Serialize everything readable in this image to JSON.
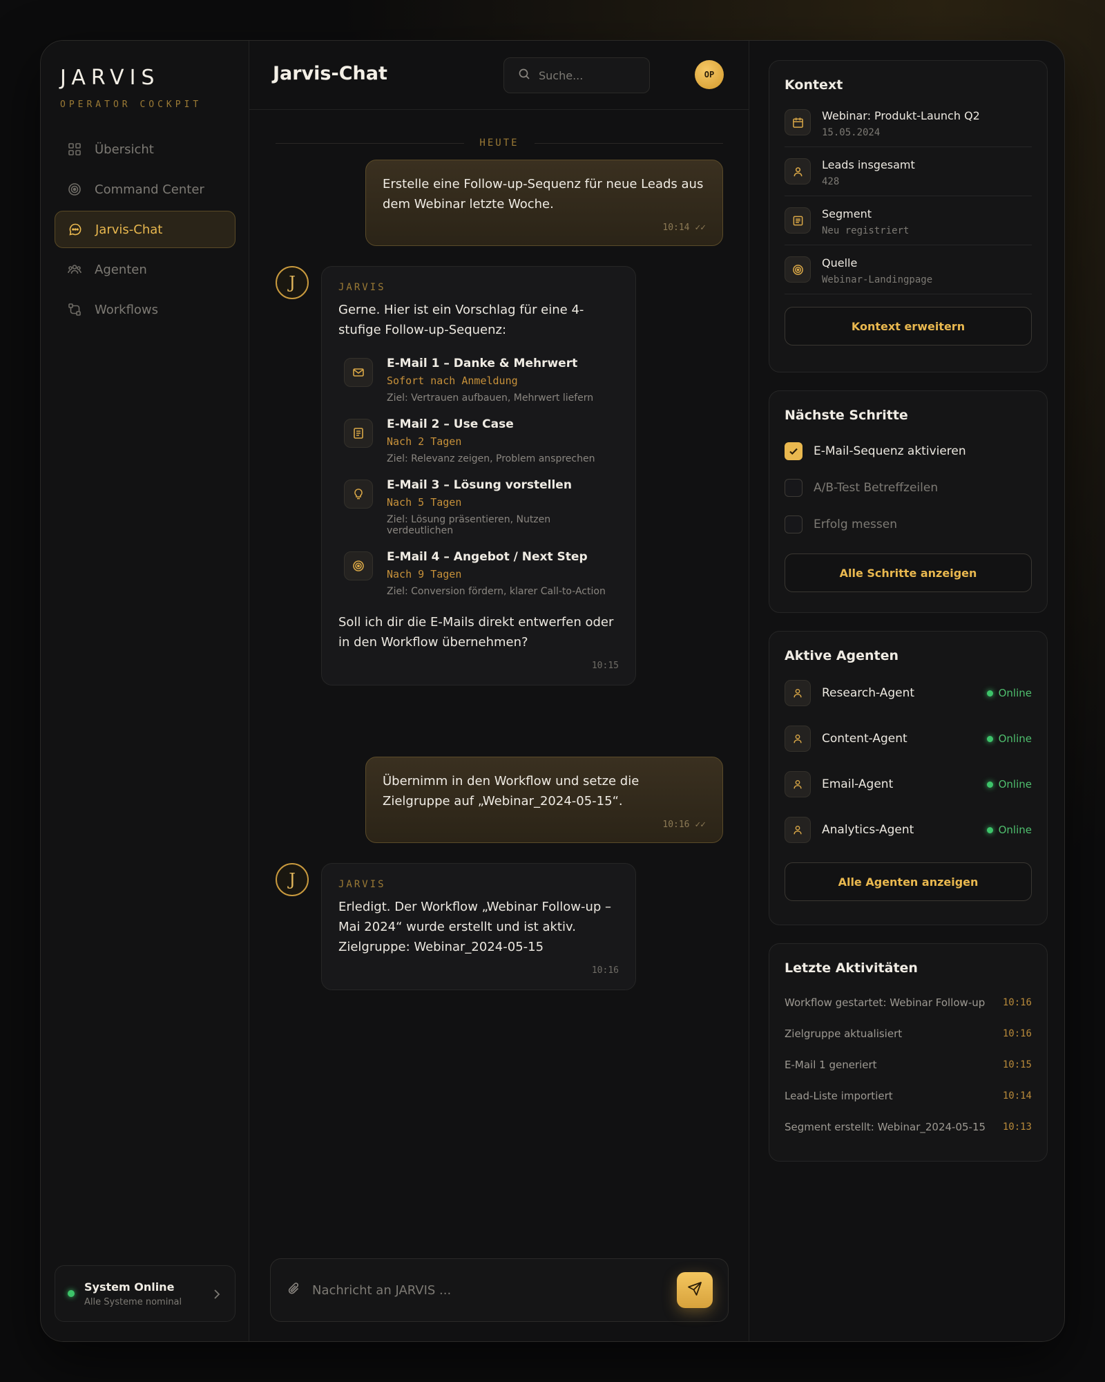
{
  "brand": {
    "name": "JARVIS",
    "subtitle": "OPERATOR COCKPIT"
  },
  "nav": [
    {
      "label": "Übersicht",
      "icon": "grid-icon",
      "active": false
    },
    {
      "label": "Command Center",
      "icon": "target-icon",
      "active": false
    },
    {
      "label": "Jarvis-Chat",
      "icon": "chat-icon",
      "active": true
    },
    {
      "label": "Agenten",
      "icon": "users-icon",
      "active": false
    },
    {
      "label": "Workflows",
      "icon": "workflow-icon",
      "active": false
    }
  ],
  "system": {
    "title": "System Online",
    "subtitle": "Alle Systeme nominal"
  },
  "header": {
    "title": "Jarvis-Chat",
    "search_placeholder": "Suche...",
    "avatar_initials": "OP"
  },
  "chat": {
    "day_label": "HEUTE",
    "messages": [
      {
        "from": "user",
        "text": "Erstelle eine Follow-up-Sequenz für neue Leads aus dem Webinar letzte Woche.",
        "time": "10:14 ✓✓"
      },
      {
        "from": "bot",
        "name": "JARVIS",
        "avatar": "J",
        "intro": "Gerne. Hier ist ein Vorschlag für eine 4-stufige Follow-up-Sequenz:",
        "steps": [
          {
            "icon": "mail-icon",
            "title": "E-Mail 1 – Danke & Mehrwert",
            "timing": "Sofort nach Anmeldung",
            "goal": "Ziel: Vertrauen aufbauen, Mehrwert liefern"
          },
          {
            "icon": "document-icon",
            "title": "E-Mail 2 – Use Case",
            "timing": "Nach 2 Tagen",
            "goal": "Ziel: Relevanz zeigen, Problem ansprechen"
          },
          {
            "icon": "lightbulb-icon",
            "title": "E-Mail 3 – Lösung vorstellen",
            "timing": "Nach 5 Tagen",
            "goal": "Ziel: Lösung präsentieren, Nutzen verdeutlichen"
          },
          {
            "icon": "target-icon",
            "title": "E-Mail 4 – Angebot / Next Step",
            "timing": "Nach 9 Tagen",
            "goal": "Ziel: Conversion fördern, klarer Call-to-Action"
          }
        ],
        "outro": "Soll ich dir die E-Mails direkt entwerfen oder in den Workflow übernehmen?",
        "time": "10:15"
      },
      {
        "from": "user",
        "text": "Übernimm in den Workflow und setze die Zielgruppe auf „Webinar_2024-05-15“.",
        "time": "10:16 ✓✓"
      },
      {
        "from": "bot",
        "name": "JARVIS",
        "avatar": "J",
        "text": "Erledigt. Der Workflow „Webinar Follow-up – Mai 2024“ wurde erstellt und ist aktiv. Zielgruppe: Webinar_2024-05-15",
        "time": "10:16"
      }
    ],
    "composer_placeholder": "Nachricht an JARVIS ..."
  },
  "context": {
    "title": "Kontext",
    "rows": [
      {
        "icon": "calendar-icon",
        "title": "Webinar: Produkt-Launch Q2",
        "value": "15.05.2024"
      },
      {
        "icon": "user-icon",
        "title": "Leads insgesamt",
        "value": "428"
      },
      {
        "icon": "list-icon",
        "title": "Segment",
        "value": "Neu registriert"
      },
      {
        "icon": "target-icon",
        "title": "Quelle",
        "value": "Webinar-Landingpage"
      }
    ],
    "button": "Kontext erweitern"
  },
  "next_steps": {
    "title": "Nächste Schritte",
    "items": [
      {
        "label": "E-Mail-Sequenz aktivieren",
        "checked": true
      },
      {
        "label": "A/B-Test Betreffzeilen",
        "checked": false
      },
      {
        "label": "Erfolg messen",
        "checked": false
      }
    ],
    "button": "Alle Schritte anzeigen"
  },
  "agents": {
    "title": "Aktive Agenten",
    "items": [
      {
        "name": "Research-Agent",
        "status": "Online"
      },
      {
        "name": "Content-Agent",
        "status": "Online"
      },
      {
        "name": "Email-Agent",
        "status": "Online"
      },
      {
        "name": "Analytics-Agent",
        "status": "Online"
      }
    ],
    "button": "Alle Agenten anzeigen"
  },
  "activities": {
    "title": "Letzte Aktivitäten",
    "items": [
      {
        "label": "Workflow gestartet: Webinar Follow-up",
        "time": "10:16"
      },
      {
        "label": "Zielgruppe aktualisiert",
        "time": "10:16"
      },
      {
        "label": "E-Mail 1 generiert",
        "time": "10:15"
      },
      {
        "label": "Lead-Liste importiert",
        "time": "10:14"
      },
      {
        "label": "Segment erstellt: Webinar_2024-05-15",
        "time": "10:13"
      }
    ]
  },
  "colors": {
    "accent": "#e9b84f",
    "online": "#3dc46a",
    "background": "#111112"
  }
}
